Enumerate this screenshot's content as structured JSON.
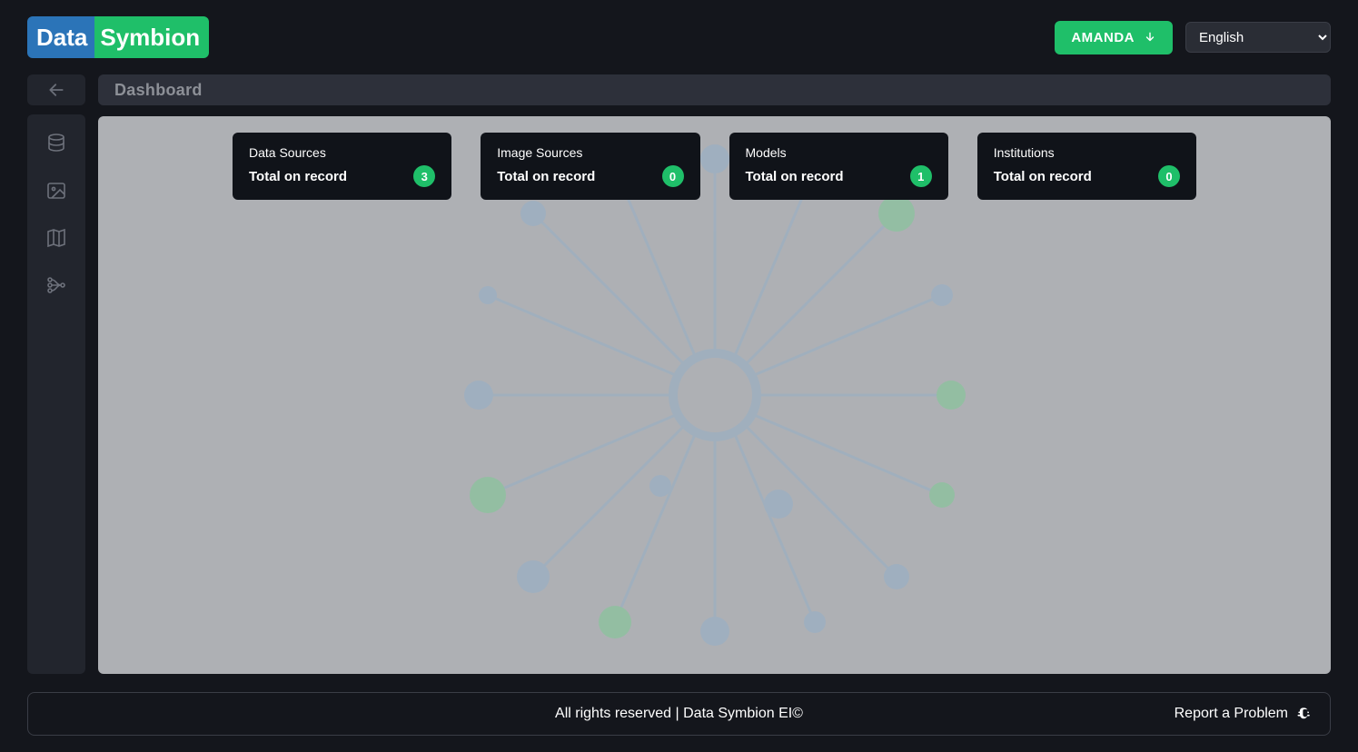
{
  "brand": {
    "left": "Data",
    "right": "Symbion"
  },
  "header": {
    "user_label": "AMANDA",
    "language_selected": "English"
  },
  "page": {
    "title": "Dashboard"
  },
  "sidebar": {
    "items": [
      {
        "name": "data-sources"
      },
      {
        "name": "image-sources"
      },
      {
        "name": "models-map"
      },
      {
        "name": "ai-network"
      }
    ]
  },
  "cards": [
    {
      "title": "Data Sources",
      "subtitle": "Total on record",
      "count": "3"
    },
    {
      "title": "Image Sources",
      "subtitle": "Total on record",
      "count": "0"
    },
    {
      "title": "Models",
      "subtitle": "Total on record",
      "count": "1"
    },
    {
      "title": "Institutions",
      "subtitle": "Total on record",
      "count": "0"
    }
  ],
  "footer": {
    "copyright": "All rights reserved | Data Symbion EI©",
    "report_label": "Report a Problem"
  }
}
